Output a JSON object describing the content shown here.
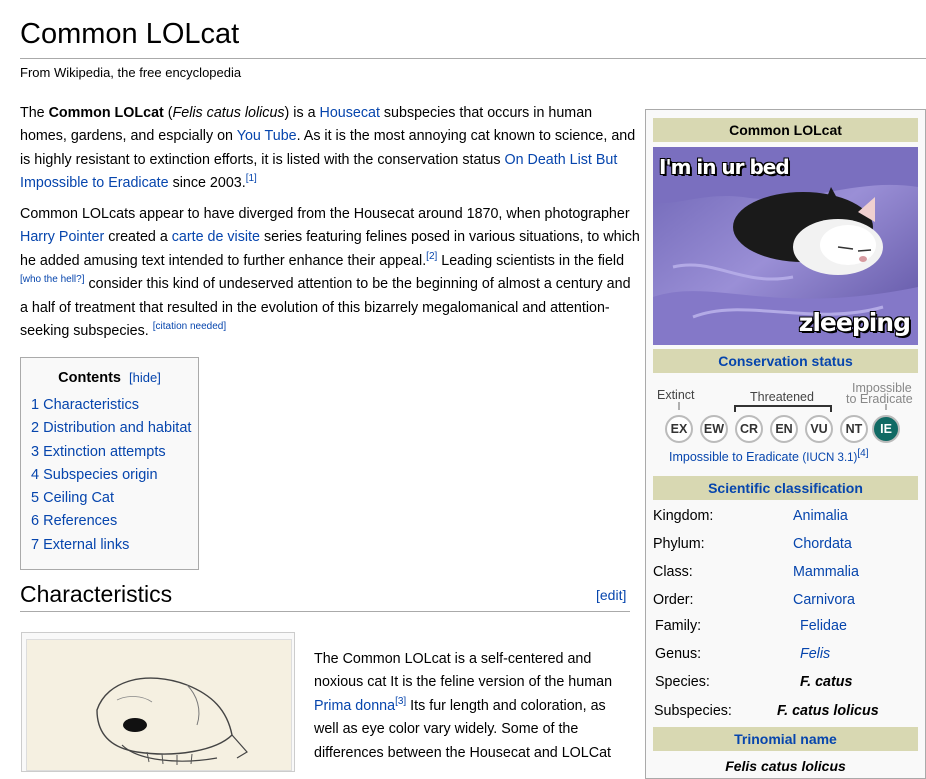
{
  "article": {
    "title": "Common LOLcat",
    "tagline": "From Wikipedia, the free encyclopedia"
  },
  "intro": {
    "p1_parts": [
      "The ",
      "Common LOLcat",
      " (",
      "Felis catus lolicus",
      ") is a ",
      "Housecat",
      " subspecies that occurs in human homes, gardens, and espcially on ",
      "You Tube",
      ".  As it is the most annoying cat known to science, and is highly resistant to extinction efforts, it is listed with the conservation status ",
      "On Death List But Impossible to Eradicate",
      " since 2003.",
      "[1]"
    ],
    "p2_parts": [
      "Common LOLcats appear to have diverged from the Housecat around 1870, when photographer ",
      "Harry Pointer",
      " created a ",
      "carte de visite",
      " series featuring felines posed in various situations, to which he added amusing text intended to further enhance their appeal.",
      "[2]",
      " Leading scientists in the field ",
      "[who the hell?]",
      " consider this kind of undeserved attention to be the beginning of almost a century and a half of treatment that resulted in the evolution of this bizarrely megalomanical and attention-seeking subspecies. ",
      "[citation needed]"
    ]
  },
  "toc": {
    "heading": "Contents",
    "hide_label": "[hide]",
    "items": [
      "1 Characteristics",
      "2 Distribution and habitat",
      "3 Extinction attempts",
      "4 Subspecies origin",
      "5 Ceiling Cat",
      "6 References",
      "7 External links"
    ]
  },
  "section": {
    "heading": "Characteristics",
    "edit_label": "[edit]",
    "p3_parts": [
      "The Common LOLcat is a self-centered and noxious cat  It is the feline version of the human ",
      "Prima donna",
      "[3]",
      "  Its fur length and coloration, as well as eye color vary widely.  Some of the differences between the Housecat and LOLCat"
    ]
  },
  "infobox": {
    "title": "Common LOLcat",
    "image_caption_top": "I'm in ur bed",
    "image_caption_bottom": "zleeping",
    "conservation_heading": "Conservation status",
    "cons_labels": {
      "extinct": "Extinct",
      "threatened": "Threatened",
      "impossible_1": "Impossible",
      "impossible_2": "to Eradicate"
    },
    "cons_codes": [
      "EX",
      "EW",
      "CR",
      "EN",
      "VU",
      "NT",
      "IE"
    ],
    "cons_active": "IE",
    "cons_status_link": "Impossible to Eradicate",
    "cons_iucn": "(IUCN 3.1)",
    "cons_ref": "[4]",
    "scientific_heading": "Scientific classification",
    "taxonomy": [
      {
        "rank": "Kingdom:",
        "name": "Animalia"
      },
      {
        "rank": "Phylum:",
        "name": "Chordata"
      },
      {
        "rank": "Class:",
        "name": "Mammalia"
      },
      {
        "rank": "Order:",
        "name": "Carnivora"
      },
      {
        "rank": "Family:",
        "name": "Felidae"
      },
      {
        "rank": "Genus:",
        "name": "Felis"
      },
      {
        "rank": "Species:",
        "name": "F. catus"
      },
      {
        "rank": "Subspecies:",
        "name": "F. catus lolicus"
      }
    ],
    "trinomial_heading": "Trinomial name",
    "trinomial": "Felis catus lolicus"
  },
  "colors": {
    "link": "#0645ad",
    "infobox_band": "#d8d8b2",
    "active_status": "#116a64"
  }
}
